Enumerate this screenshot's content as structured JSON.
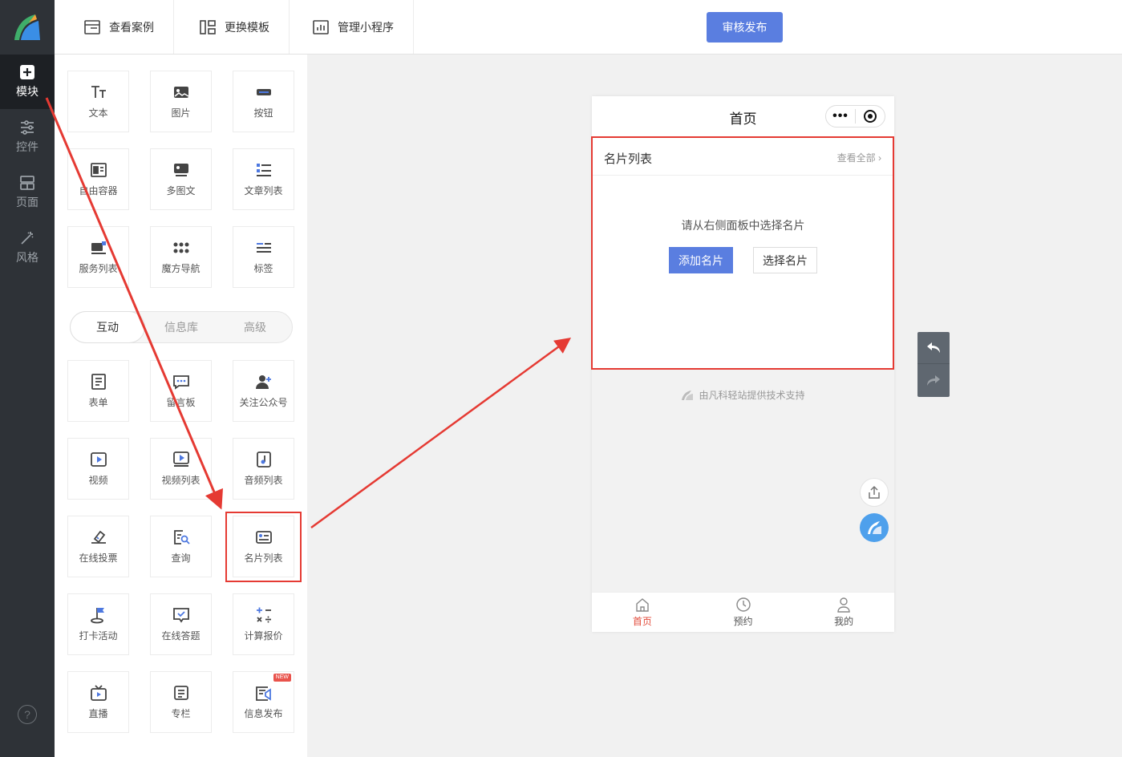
{
  "sidebar": {
    "items": [
      {
        "label": "模块",
        "icon": "plus-square-icon"
      },
      {
        "label": "控件",
        "icon": "sliders-icon"
      },
      {
        "label": "页面",
        "icon": "layout-icon"
      },
      {
        "label": "风格",
        "icon": "magic-wand-icon"
      }
    ],
    "help": "?"
  },
  "topbar": {
    "tabs": [
      {
        "label": "查看案例",
        "icon": "browser-window-icon"
      },
      {
        "label": "更换模板",
        "icon": "template-icon"
      },
      {
        "label": "管理小程序",
        "icon": "bar-chart-icon"
      }
    ],
    "publish_label": "审核发布"
  },
  "panel": {
    "basic": [
      {
        "label": "文本",
        "icon": "text-icon"
      },
      {
        "label": "图片",
        "icon": "image-icon"
      },
      {
        "label": "按钮",
        "icon": "button-icon"
      },
      {
        "label": "自由容器",
        "icon": "container-icon"
      },
      {
        "label": "多图文",
        "icon": "multi-image-icon"
      },
      {
        "label": "文章列表",
        "icon": "article-list-icon"
      },
      {
        "label": "服务列表",
        "icon": "service-list-icon"
      },
      {
        "label": "魔方导航",
        "icon": "grid-dots-icon"
      },
      {
        "label": "标签",
        "icon": "tag-lines-icon"
      }
    ],
    "segments": [
      "互动",
      "信息库",
      "高级"
    ],
    "interactive": [
      {
        "label": "表单",
        "icon": "form-icon"
      },
      {
        "label": "留言板",
        "icon": "message-board-icon"
      },
      {
        "label": "关注公众号",
        "icon": "follow-user-icon"
      },
      {
        "label": "视频",
        "icon": "video-icon"
      },
      {
        "label": "视频列表",
        "icon": "video-list-icon"
      },
      {
        "label": "音频列表",
        "icon": "audio-list-icon"
      },
      {
        "label": "在线投票",
        "icon": "vote-icon"
      },
      {
        "label": "查询",
        "icon": "query-icon"
      },
      {
        "label": "名片列表",
        "icon": "card-list-icon"
      },
      {
        "label": "打卡活动",
        "icon": "checkin-flag-icon"
      },
      {
        "label": "在线答题",
        "icon": "quiz-icon"
      },
      {
        "label": "计算报价",
        "icon": "calculator-icon"
      },
      {
        "label": "直播",
        "icon": "live-tv-icon"
      },
      {
        "label": "专栏",
        "icon": "column-icon"
      },
      {
        "label": "信息发布",
        "icon": "publish-info-icon",
        "badge": "NEW"
      }
    ]
  },
  "phone": {
    "title": "首页",
    "capsule_dots": "•••",
    "card": {
      "title": "名片列表",
      "view_all": "查看全部",
      "empty_tip": "请从右侧面板中选择名片",
      "add_label": "添加名片",
      "choose_label": "选择名片"
    },
    "support_text": "由凡科轻站提供技术支持",
    "tabs": [
      {
        "label": "首页",
        "icon": "home-icon"
      },
      {
        "label": "预约",
        "icon": "clock-icon"
      },
      {
        "label": "我的",
        "icon": "user-icon"
      }
    ]
  },
  "colors": {
    "sidebar": "#2e3237",
    "primary": "#5a7ee0",
    "annotation": "#e53a33",
    "tab_active": "#e24b3b"
  }
}
